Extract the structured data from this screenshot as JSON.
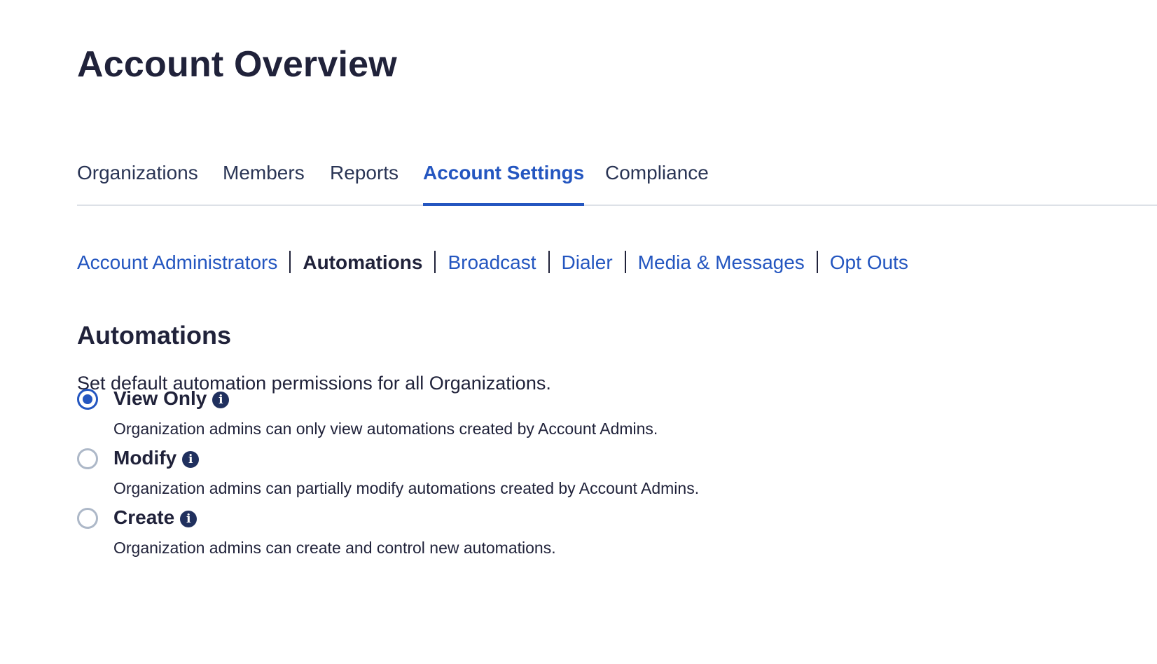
{
  "page": {
    "title": "Account Overview"
  },
  "tabs": [
    {
      "label": "Organizations",
      "active": false
    },
    {
      "label": "Members",
      "active": false
    },
    {
      "label": "Reports",
      "active": false
    },
    {
      "label": "Account Settings",
      "active": true
    },
    {
      "label": "Compliance",
      "active": false
    }
  ],
  "subnav": [
    {
      "label": "Account Administrators",
      "current": false
    },
    {
      "label": "Automations",
      "current": true
    },
    {
      "label": "Broadcast",
      "current": false
    },
    {
      "label": "Dialer",
      "current": false
    },
    {
      "label": "Media & Messages",
      "current": false
    },
    {
      "label": "Opt Outs",
      "current": false
    }
  ],
  "section": {
    "title": "Automations",
    "description": "Set default automation permissions for all Organizations."
  },
  "options": [
    {
      "label": "View Only",
      "help": "Organization admins can only view automations created by Account Admins.",
      "selected": true,
      "icon": "info-icon",
      "icon_glyph": "i"
    },
    {
      "label": "Modify",
      "help": "Organization admins can partially modify automations created by Account Admins.",
      "selected": false,
      "icon": "info-icon",
      "icon_glyph": "i"
    },
    {
      "label": "Create",
      "help": "Organization admins can create and control new automations.",
      "selected": false,
      "icon": "info-icon",
      "icon_glyph": "i"
    }
  ],
  "colors": {
    "accent": "#2456c0",
    "text": "#20223a",
    "divider": "#dde1e7",
    "radio_unchecked": "#adb8c8"
  }
}
